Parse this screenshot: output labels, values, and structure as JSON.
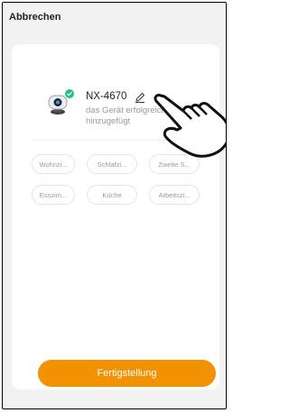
{
  "header": {
    "cancel_label": "Abbrechen"
  },
  "device": {
    "name": "NX-4670",
    "status": "das Gerät erfolgreich hinzugefügt",
    "status_icon": "check-icon",
    "camera_icon": "camera-icon",
    "edit_icon": "pencil-icon"
  },
  "rooms": [
    {
      "label": "Wohnzi..."
    },
    {
      "label": "Schlafzi..."
    },
    {
      "label": "Zweite S..."
    },
    {
      "label": "Esszim..."
    },
    {
      "label": "Küche"
    },
    {
      "label": "Arbeitszi..."
    }
  ],
  "footer": {
    "finish_label": "Fertigstellung"
  },
  "colors": {
    "accent": "#f39200",
    "success": "#1fbf8f",
    "background": "#f2f2f2",
    "card": "#ffffff"
  }
}
